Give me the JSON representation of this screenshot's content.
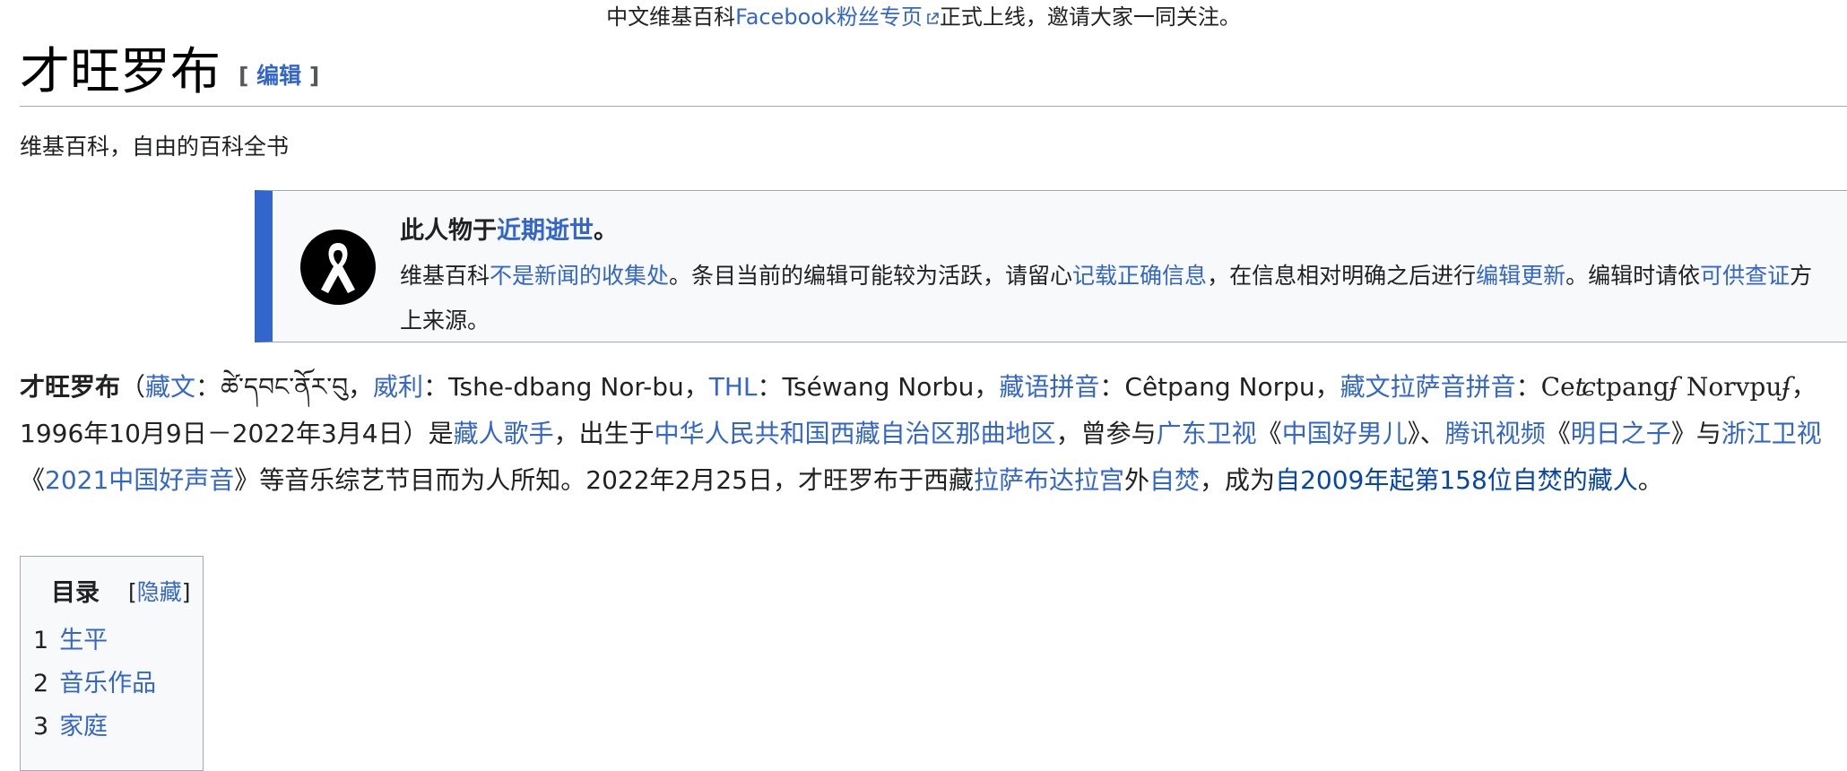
{
  "site_notice": {
    "prefix": "中文维基百科",
    "link": "Facebook粉丝专页",
    "suffix": "正式上线，邀请大家一同关注。",
    "icon": "external-link-icon"
  },
  "heading": {
    "title": "才旺罗布",
    "edit_open": "[",
    "edit_label": "编辑",
    "edit_close": "]"
  },
  "tagline": "维基百科，自由的百科全书",
  "notice": {
    "icon": "black-ribbon-icon",
    "title_prefix": "此人物于",
    "title_link": "近期逝世",
    "title_suffix": "。",
    "body": [
      "维基百科",
      "不是新闻的收集处",
      "。条目当前的编辑可能较为活跃，请留心",
      "记载正确信息",
      "，在信息相对明确之后进行",
      "编辑更新",
      "。编辑时请依",
      "可供查证",
      "方",
      "上来源。"
    ]
  },
  "lead": {
    "name": "才旺罗布",
    "p1": "（",
    "tibetan_link": "藏文",
    "colon1": "：",
    "tibetan": "ཚེ་དབང་ནོར་བུ",
    "comma1": "，",
    "wylie_link": "威利",
    "wylie": "：Tshe-dbang Nor-bu，",
    "thl_link": "THL",
    "thl": "：Tséwang Norbu，",
    "pinyin_link": "藏语拼音",
    "pinyin": "：Cêtpang Norpu，",
    "lhasa_link": "藏文拉萨音拼音",
    "lhasa_colon": "：",
    "lhasa_a": "Ce",
    "lhasa_b": "ʨ",
    "lhasa_c": "tpang",
    "lhasa_d": "ʄ",
    "lhasa_e": " Norvpu",
    "lhasa_f": "ʄ",
    "dates": "，1996年10月9日－2022年3月4日）是",
    "singer_link": "藏人歌手",
    "born": "，出生于",
    "place_link": "中华人民共和国西藏自治区那曲地区",
    "joined": "，曾参与",
    "gdtv_link": "广东卫视",
    "q1": "《",
    "show1_link": "中国好男儿",
    "q2": "》、",
    "tencent_link": "腾讯视频",
    "q3": "《",
    "show2_link": "明日之子",
    "q4": "》与",
    "zjtv_link": "浙江卫视",
    "q5": "《",
    "show3_link": "2021中国好声音",
    "known": "》等音乐综艺节目而为人所知。2022年2月25日，才旺罗布于西藏",
    "potala_link": "拉萨布达拉宫",
    "outside": "外",
    "immolation_link": "自焚",
    "became": "，成为",
    "list_link": "自2009年起第158位自焚的藏人",
    "end": "。"
  },
  "toc": {
    "title": "目录",
    "toggle_open": "[",
    "toggle_label": "隐藏",
    "toggle_close": "]",
    "items": [
      {
        "num": "1",
        "label": "生平"
      },
      {
        "num": "2",
        "label": "音乐作品"
      },
      {
        "num": "3",
        "label": "家庭"
      }
    ]
  },
  "colors": {
    "link": "#3366cc",
    "visited_link": "#0645ad",
    "notice_accent": "#3366cc",
    "notice_bg": "#f8f9fa",
    "border": "#a2a9b1"
  }
}
